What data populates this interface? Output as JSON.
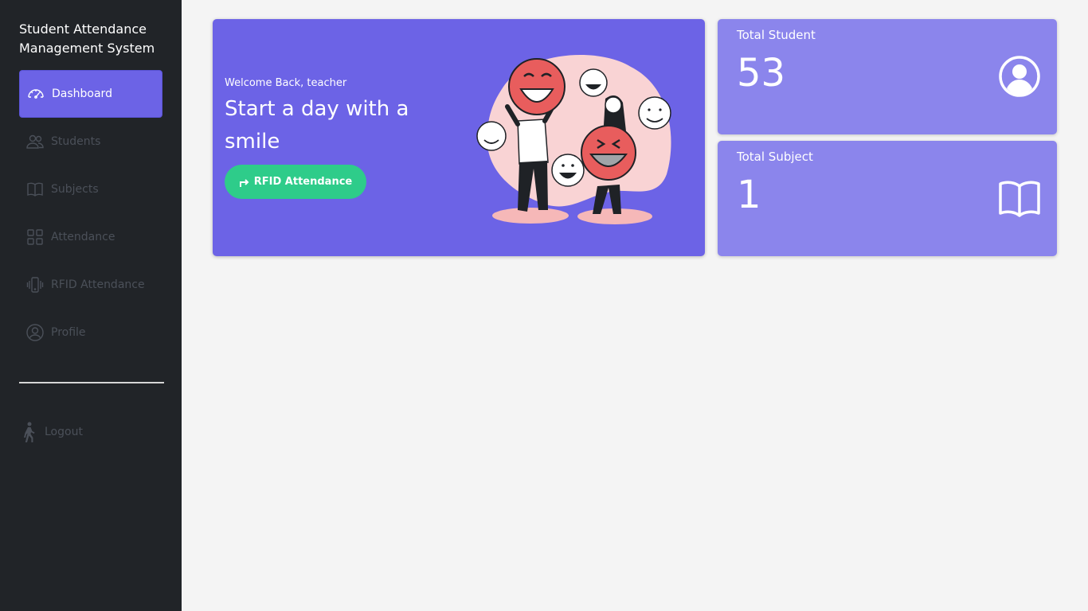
{
  "sidebar": {
    "title": "Student Attendance Management System",
    "items": [
      {
        "label": "Dashboard",
        "icon": "speedometer-icon"
      },
      {
        "label": "Students",
        "icon": "people-icon"
      },
      {
        "label": "Subjects",
        "icon": "book-icon"
      },
      {
        "label": "Attendance",
        "icon": "grid-icon"
      },
      {
        "label": "RFID Attendance",
        "icon": "phone-vibrate-icon"
      },
      {
        "label": "Profile",
        "icon": "person-circle-icon"
      }
    ],
    "logout_label": "Logout"
  },
  "hero": {
    "welcome": "Welcome Back, teacher",
    "headline": "Start a day with a smile",
    "button_label": "RFID Attendance"
  },
  "cards": [
    {
      "label": "Total Student",
      "value": "53",
      "icon": "person-circle-icon"
    },
    {
      "label": "Total Subject",
      "value": "1",
      "icon": "book-icon"
    }
  ],
  "colors": {
    "sidebar_bg": "#212428",
    "accent": "#6c63e6",
    "card_bg": "#8b85ec",
    "button": "#2ecc8a",
    "page_bg": "#f4f4f4"
  }
}
